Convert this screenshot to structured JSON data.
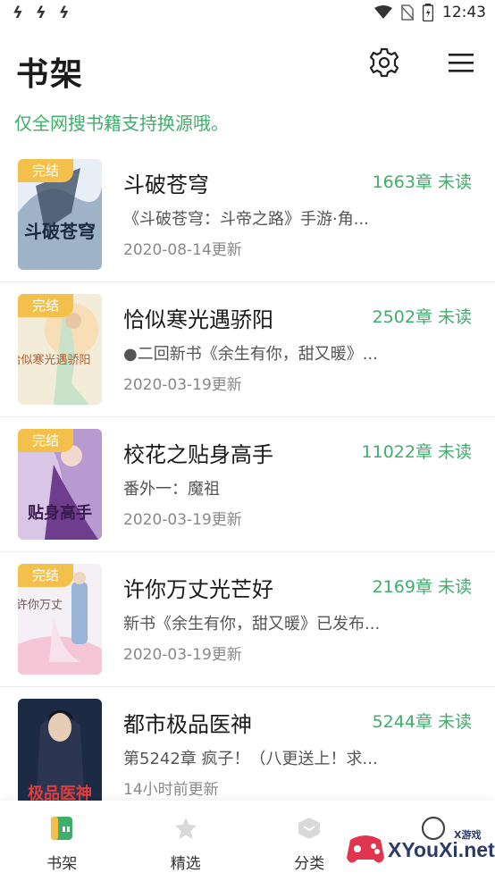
{
  "status_bar": {
    "left_icons": [
      "ϟ",
      "ϟ",
      "ϟ"
    ],
    "time": "12:43"
  },
  "header": {
    "title": "书架",
    "settings_icon": "gear-icon",
    "menu_icon": "hamburger-menu-icon"
  },
  "notice": "仅全网搜书籍支持换源哦。",
  "books": [
    {
      "title": "斗破苍穹",
      "chapters": "1663章 未读",
      "desc": "《斗破苍穹：斗帝之路》手游·角...",
      "update": "2020-08-14更新",
      "badge": "完结",
      "cover_text": "斗破苍穹"
    },
    {
      "title": "恰似寒光遇骄阳",
      "chapters": "2502章 未读",
      "desc": "●二回新书《余生有你，甜又暖》...",
      "update": "2020-03-19更新",
      "badge": "完结",
      "cover_text": "恰似寒光遇骄阳"
    },
    {
      "title": "校花之贴身高手",
      "chapters": "11022章 未读",
      "desc": "番外一：魔祖",
      "update": "2020-03-19更新",
      "badge": "完结",
      "cover_text": "贴身高手"
    },
    {
      "title": "许你万丈光芒好",
      "chapters": "2169章 未读",
      "desc": "新书《余生有你，甜又暖》已发布...",
      "update": "2020-03-19更新",
      "badge": "完结",
      "cover_text": "许你万丈"
    },
    {
      "title": "都市极品医神",
      "chapters": "5244章 未读",
      "desc": "第5242章 疯子！（八更送上！求...",
      "update": "14小时前更新",
      "badge": "",
      "cover_text": "极品医神"
    }
  ],
  "bottom_nav": [
    {
      "label": "书架",
      "icon": "bookshelf-icon"
    },
    {
      "label": "精选",
      "icon": "star-icon"
    },
    {
      "label": "分类",
      "icon": "category-icon"
    },
    {
      "label": "",
      "icon": "profile-icon"
    }
  ],
  "watermark": {
    "text": "XYouXi.net",
    "sub": "X游戏"
  },
  "colors": {
    "accent_green": "#3fae6b",
    "badge_yellow": "#f3c14b"
  }
}
